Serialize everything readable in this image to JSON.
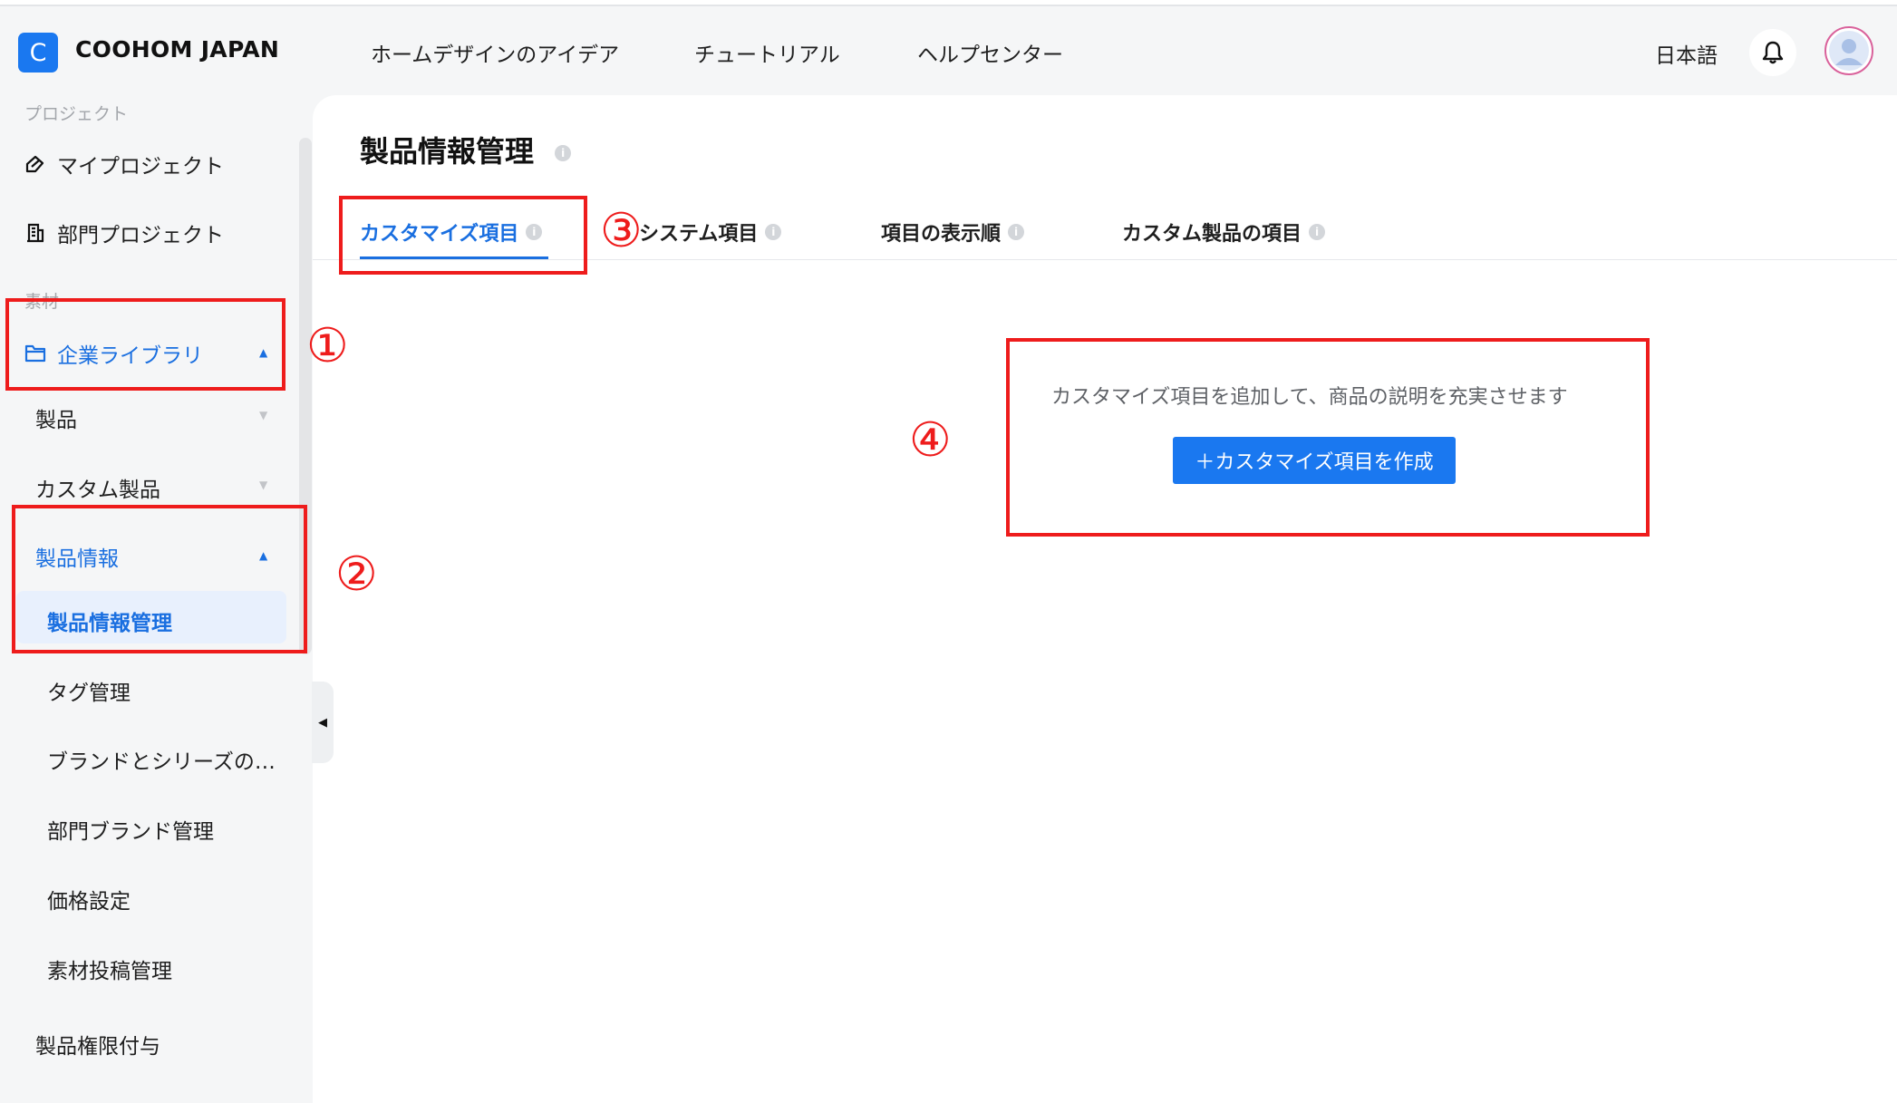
{
  "header": {
    "logo_letter": "C",
    "brand": "COOHOM JAPAN",
    "nav": [
      "ホームデザインのアイデア",
      "チュートリアル",
      "ヘルプセンター"
    ],
    "language": "日本語"
  },
  "sidebar": {
    "section_project": "プロジェクト",
    "my_project": "マイプロジェクト",
    "dept_project": "部門プロジェクト",
    "section_material": "素材",
    "enterprise_library": "企業ライブラリ",
    "products": "製品",
    "custom_products": "カスタム製品",
    "product_info": "製品情報",
    "product_info_management": "製品情報管理",
    "tag_management": "タグ管理",
    "brand_series": "ブランドとシリーズの…",
    "dept_brand_management": "部門ブランド管理",
    "price_settings": "価格設定",
    "material_submission": "素材投稿管理",
    "product_permissions": "製品権限付与"
  },
  "main": {
    "title": "製品情報管理",
    "tabs": [
      "カスタマイズ項目",
      "システム項目",
      "項目の表示順",
      "カスタム製品の項目"
    ],
    "active_tab": "カスタマイズ項目",
    "empty_message": "カスタマイズ項目を追加して、商品の説明を充実させます",
    "create_button": "＋カスタマイズ項目を作成"
  },
  "annotations": {
    "m1": "①",
    "m2": "②",
    "m3": "③",
    "m4": "④"
  },
  "colors": {
    "accent": "#1a78f0",
    "annotation_red": "#ee1c1c",
    "active_bg": "#e8f0fd"
  },
  "icons": [
    "project-pen-icon",
    "building-icon",
    "folder-icon",
    "bell-icon",
    "user-avatar-icon",
    "info-icon",
    "collapse-arrow-icon"
  ]
}
